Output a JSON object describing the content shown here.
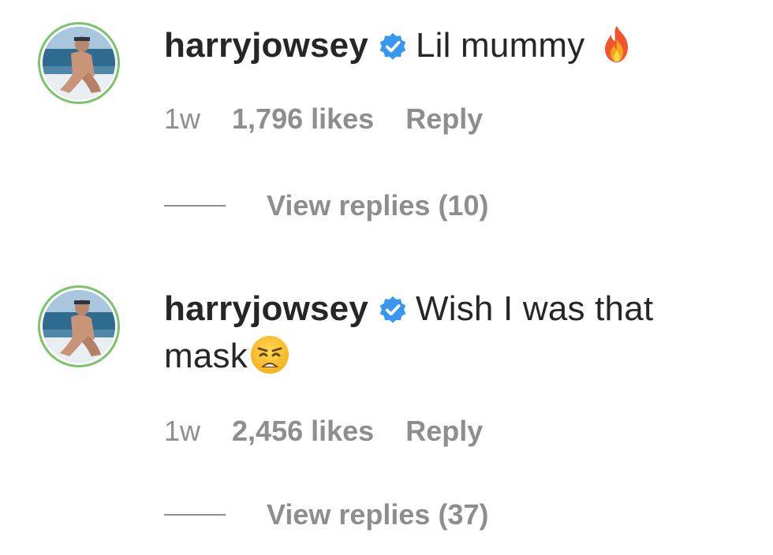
{
  "comments": [
    {
      "username": "harryjowsey",
      "text": "Lil mummy",
      "emoji": "fire-emoji",
      "time": "1w",
      "likes": "1,796 likes",
      "reply_label": "Reply",
      "view_replies": "View replies (10)"
    },
    {
      "username": "harryjowsey",
      "text_line1": "Wish I was that",
      "text_line2": "mask",
      "emoji": "weary-face-emoji",
      "time": "1w",
      "likes": "2,456 likes",
      "reply_label": "Reply",
      "view_replies": "View replies (37)"
    }
  ],
  "colors": {
    "text": "#262626",
    "secondary": "#8e8e8e",
    "verified": "#3897f0",
    "avatar_ring": "#7bc46a"
  },
  "icons": {
    "verified": "verified-badge-icon",
    "avatar": "profile-avatar"
  }
}
